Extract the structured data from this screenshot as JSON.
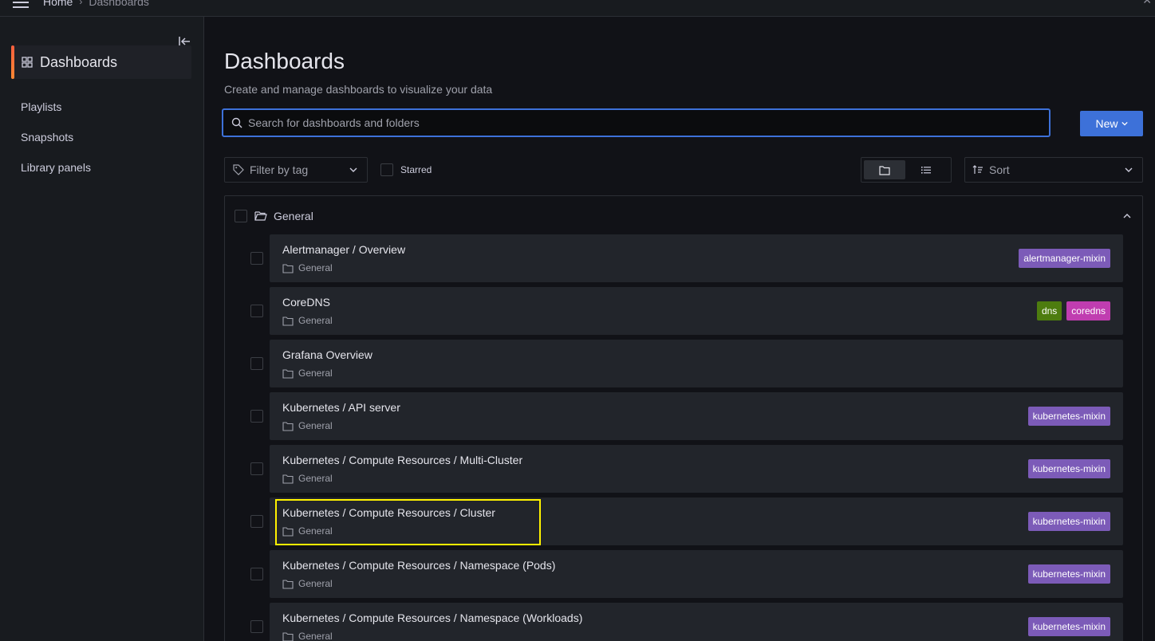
{
  "breadcrumb": {
    "home": "Home",
    "current": "Dashboards"
  },
  "sidebar": {
    "title": "Dashboards",
    "items": [
      {
        "label": "Playlists"
      },
      {
        "label": "Snapshots"
      },
      {
        "label": "Library panels"
      }
    ]
  },
  "page": {
    "title": "Dashboards",
    "subtitle": "Create and manage dashboards to visualize your data"
  },
  "search": {
    "placeholder": "Search for dashboards and folders"
  },
  "new_button": {
    "label": "New"
  },
  "filters": {
    "tag_placeholder": "Filter by tag",
    "starred_label": "Starred",
    "sort_label": "Sort"
  },
  "folder": {
    "name": "General"
  },
  "dashboards": [
    {
      "title": "Alertmanager / Overview",
      "folder": "General",
      "tags": [
        {
          "label": "alertmanager-mixin",
          "color": "#7c5bb8"
        }
      ]
    },
    {
      "title": "CoreDNS",
      "folder": "General",
      "tags": [
        {
          "label": "dns",
          "color": "#4d7c0f"
        },
        {
          "label": "coredns",
          "color": "#c03db0"
        }
      ]
    },
    {
      "title": "Grafana Overview",
      "folder": "General",
      "tags": []
    },
    {
      "title": "Kubernetes / API server",
      "folder": "General",
      "tags": [
        {
          "label": "kubernetes-mixin",
          "color": "#7c5bb8"
        }
      ]
    },
    {
      "title": "Kubernetes / Compute Resources / Multi-Cluster",
      "folder": "General",
      "tags": [
        {
          "label": "kubernetes-mixin",
          "color": "#7c5bb8"
        }
      ]
    },
    {
      "title": "Kubernetes / Compute Resources / Cluster",
      "folder": "General",
      "tags": [
        {
          "label": "kubernetes-mixin",
          "color": "#7c5bb8"
        }
      ]
    },
    {
      "title": "Kubernetes / Compute Resources / Namespace (Pods)",
      "folder": "General",
      "tags": [
        {
          "label": "kubernetes-mixin",
          "color": "#7c5bb8"
        }
      ]
    },
    {
      "title": "Kubernetes / Compute Resources / Namespace (Workloads)",
      "folder": "General",
      "tags": [
        {
          "label": "kubernetes-mixin",
          "color": "#7c5bb8"
        }
      ]
    }
  ]
}
